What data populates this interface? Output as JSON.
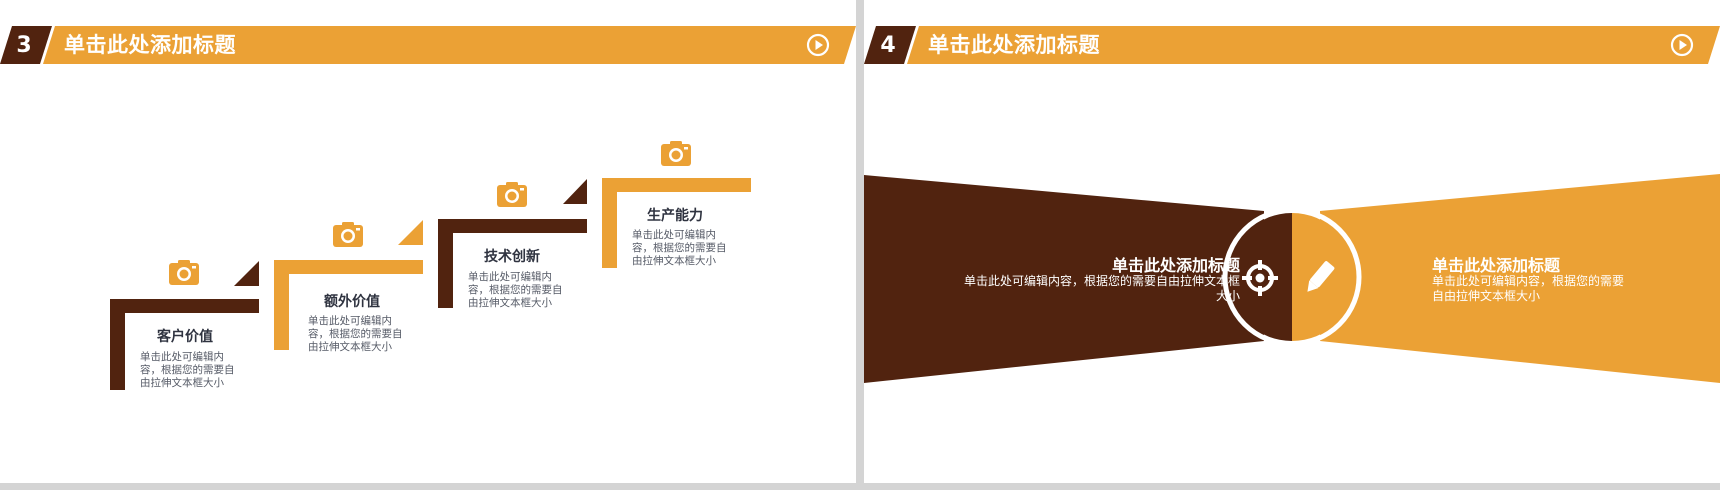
{
  "slide3": {
    "number": "3",
    "title": "单击此处添加标题",
    "steps": [
      {
        "title": "客户价值",
        "body": "单击此处可编辑内容，根据您的需要自由拉伸文本框大小"
      },
      {
        "title": "额外价值",
        "body": "单击此处可编辑内容，根据您的需要自由拉伸文本框大小"
      },
      {
        "title": "技术创新",
        "body": "单击此处可编辑内容，根据您的需要自由拉伸文本框大小"
      },
      {
        "title": "生产能力",
        "body": "单击此处可编辑内容，根据您的需要自由拉伸文本框大小"
      }
    ]
  },
  "slide4": {
    "number": "4",
    "title": "单击此处添加标题",
    "left": {
      "title": "单击此处添加标题",
      "body": "单击此处可编辑内容，根据您的需要自由拉伸文本框大小"
    },
    "right": {
      "title": "单击此处添加标题",
      "body": "单击此处可编辑内容，根据您的需要自由拉伸文本框大小"
    }
  },
  "colors": {
    "accent": "#eba135",
    "dark": "#51230f",
    "text": "#2f3340"
  },
  "icons": [
    "play-icon",
    "camera-icon",
    "target-icon",
    "pencil-icon"
  ]
}
